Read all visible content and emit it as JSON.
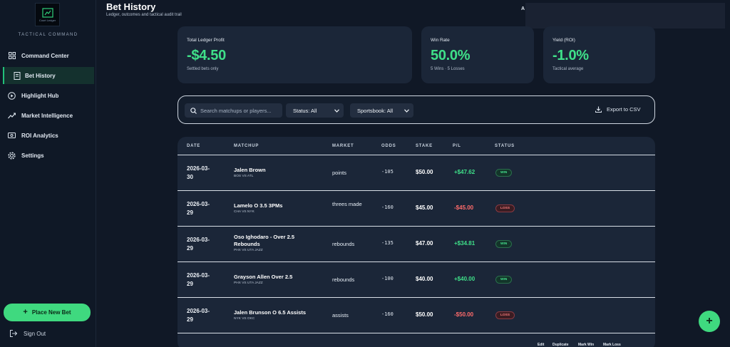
{
  "sidebar": {
    "logo_text": "Court Ledger",
    "brand_subtitle": "TACTICAL COMMAND",
    "items": [
      {
        "label": "Command Center",
        "icon": "grid-icon"
      },
      {
        "label": "Bet History",
        "icon": "receipt-icon",
        "active": true
      },
      {
        "label": "Highlight Hub",
        "icon": "play-circle-icon"
      },
      {
        "label": "Market Intelligence",
        "icon": "trend-chart-icon"
      },
      {
        "label": "ROI Analytics",
        "icon": "wallet-icon"
      },
      {
        "label": "Settings",
        "icon": "gear-icon"
      }
    ],
    "place_bet_label": "Place New Bet",
    "sign_out_label": "Sign Out"
  },
  "header": {
    "title": "Bet History",
    "subtitle": "Ledger, outcomes and tactical audit trail",
    "right_initial": "A"
  },
  "stats": [
    {
      "label": "Total Ledger Profit",
      "value": "-$4.50",
      "note": "Settled bets only"
    },
    {
      "label": "Win Rate",
      "value": "50.0%",
      "note": "5 Wins · 5 Losses"
    },
    {
      "label": "Yield (ROI)",
      "value": "-1.0%",
      "note": "Tactical average"
    }
  ],
  "filters": {
    "search_placeholder": "Search matchups or players...",
    "status_select": "Status: All",
    "sportsbook_select": "Sportsbook: All",
    "export_label": "Export to CSV"
  },
  "table": {
    "headers": [
      "DATE",
      "MATCHUP",
      "MARKET",
      "ODDS",
      "STAKE",
      "P/L",
      "STATUS"
    ],
    "rows": [
      {
        "date": "2026-03-30",
        "matchup": "Jalen Brown",
        "teams": "BOS VS ATL",
        "market": "points",
        "odds": "-105",
        "stake": "$50.00",
        "pl": "+$47.62",
        "status": "WIN"
      },
      {
        "date": "2026-03-29",
        "matchup": "Lamelo O 3.5 3PMs",
        "teams": "CHA VS NYK",
        "market": "threes made",
        "odds": "-160",
        "stake": "$45.00",
        "pl": "-$45.00",
        "status": "LOSS"
      },
      {
        "date": "2026-03-29",
        "matchup": "Oso Ighodaro - Over 2.5 Rebounds",
        "teams": "PHX VS UTA JAZZ",
        "market": "rebounds",
        "odds": "-135",
        "stake": "$47.00",
        "pl": "+$34.81",
        "status": "WIN"
      },
      {
        "date": "2026-03-29",
        "matchup": "Grayson Allen Over 2.5",
        "teams": "PHX VS UTA JAZZ",
        "market": "rebounds",
        "odds": "-100",
        "stake": "$40.00",
        "pl": "+$40.00",
        "status": "WIN"
      },
      {
        "date": "2026-03-29",
        "matchup": "Jalen Brunson O 6.5 Assists",
        "teams": "NYK VS OKC",
        "market": "assists",
        "odds": "-160",
        "stake": "$50.00",
        "pl": "-$50.00",
        "status": "LOSS"
      }
    ],
    "row_actions": [
      "Edit",
      "Duplicate",
      "Mark Win",
      "Mark Loss"
    ]
  },
  "fab_label": "+"
}
